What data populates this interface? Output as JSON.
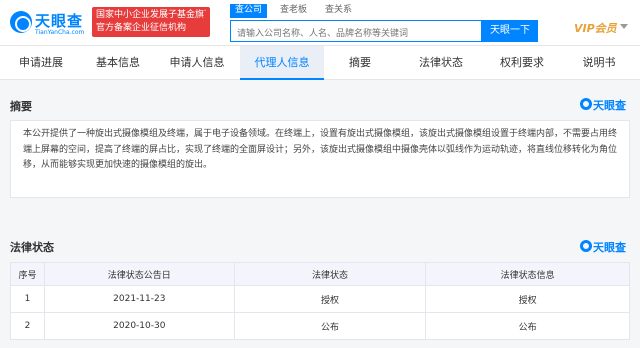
{
  "header": {
    "logo_name": "天眼查",
    "logo_domain": "TianYanCha.com",
    "badge_line1": "国家中小企业发展子基金旗下",
    "badge_line2": "官方备案企业征信机构",
    "search_tabs": [
      "查公司",
      "查老板",
      "查关系"
    ],
    "search_placeholder": "请输入公司名称、人名、品牌名称等关键词",
    "search_button": "天眼一下",
    "vip_label": "VIP会员"
  },
  "tabs": [
    "申请进展",
    "基本信息",
    "申请人信息",
    "代理人信息",
    "摘要",
    "法律状态",
    "权利要求",
    "说明书"
  ],
  "summary": {
    "title": "摘要",
    "brand": "天眼查",
    "text": "本公开提供了一种旋出式摄像模组及终端，属于电子设备领域。在终端上，设置有旋出式摄像模组，该旋出式摄像模组设置于终端内部，不需要占用终端上屏幕的空间，提高了终端的屏占比，实现了终端的全面屏设计；另外，该旋出式摄像模组中摄像壳体以弧线作为运动轨迹，将直线位移转化为角位移，从而能够实现更加快速的摄像模组的旋出。"
  },
  "legal": {
    "title": "法律状态",
    "brand": "天眼查",
    "columns": [
      "序号",
      "法律状态公告日",
      "法律状态",
      "法律状态信息"
    ],
    "rows": [
      {
        "no": "1",
        "date": "2021-11-23",
        "status": "授权",
        "info": "授权"
      },
      {
        "no": "2",
        "date": "2020-10-30",
        "status": "公布",
        "info": "公布"
      }
    ]
  }
}
